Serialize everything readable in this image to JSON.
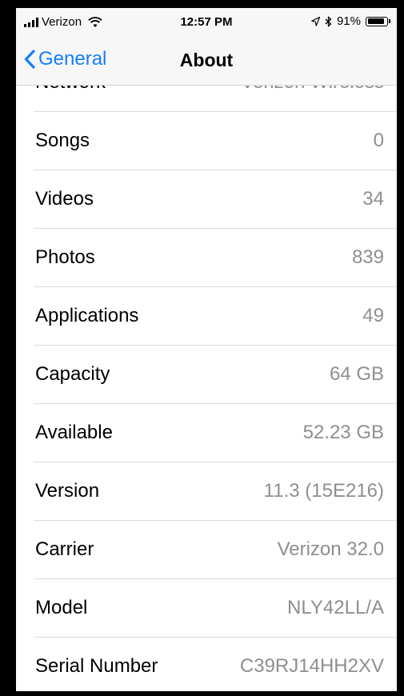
{
  "status_bar": {
    "carrier": "Verizon",
    "time": "12:57 PM",
    "battery_percent": "91%",
    "battery_level": 0.91,
    "icons": [
      "signal-icon",
      "wifi-icon",
      "location-icon",
      "bluetooth-icon",
      "battery-icon"
    ]
  },
  "nav": {
    "back_label": "General",
    "title": "About"
  },
  "rows": [
    {
      "label": "Network",
      "value": "Verizon Wireless"
    },
    {
      "label": "Songs",
      "value": "0"
    },
    {
      "label": "Videos",
      "value": "34"
    },
    {
      "label": "Photos",
      "value": "839"
    },
    {
      "label": "Applications",
      "value": "49"
    },
    {
      "label": "Capacity",
      "value": "64 GB"
    },
    {
      "label": "Available",
      "value": "52.23 GB"
    },
    {
      "label": "Version",
      "value": "11.3 (15E216)"
    },
    {
      "label": "Carrier",
      "value": "Verizon 32.0"
    },
    {
      "label": "Model",
      "value": "NLY42LL/A"
    },
    {
      "label": "Serial Number",
      "value": "C39RJ14HH2XV"
    }
  ],
  "colors": {
    "accent": "#147efb",
    "secondary_text": "#8e8e93",
    "bar_background": "#f7f7f7",
    "separator": "#dcdcdf"
  }
}
